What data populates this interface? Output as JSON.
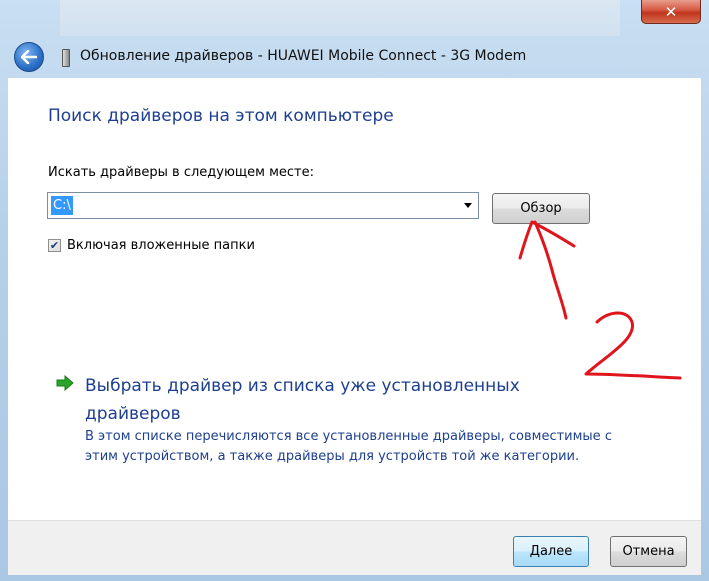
{
  "window": {
    "title": "Обновление драйверов - HUAWEI Mobile Connect - 3G Modem",
    "close_label": "✕"
  },
  "content": {
    "heading": "Поиск драйверов на этом компьютере",
    "search_label": "Искать драйверы в следующем месте:",
    "path_value": "C:\\",
    "browse_label": "Обзор",
    "include_subfolders_label": "Включая вложенные папки",
    "include_subfolders_checked": true,
    "pick_driver_title": "Выбрать драйвер из списка уже установленных драйверов",
    "pick_driver_desc": "В этом списке перечисляются все установленные драйверы, совместимые с этим устройством, а также драйверы для устройств той же категории."
  },
  "footer": {
    "next_label": "Далее",
    "cancel_label": "Отмена"
  },
  "annotation": {
    "number": "2",
    "color": "#e0141b"
  },
  "icons": {
    "back": "back-arrow-icon",
    "device": "usb-device-icon",
    "link": "green-arrow-icon",
    "dropdown": "chevron-down-icon"
  }
}
